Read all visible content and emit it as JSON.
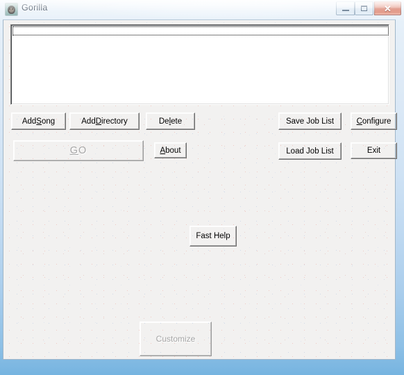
{
  "window": {
    "title": "Gorilla",
    "icon": "gorilla-icon",
    "controls": {
      "minimize_label": "–",
      "maximize_label": "□",
      "close_label": "✕"
    },
    "colors": {
      "frame_glass": "#a9cdec",
      "client_background": "#f2f1f0",
      "close_button": "#cf5f48",
      "title_text": "#16273c",
      "disabled_text": "#a6a6a6"
    }
  },
  "list_box": {
    "name": "job-list",
    "items": [],
    "focused": true,
    "empty": true
  },
  "buttons": {
    "add_song": {
      "label_before": "Add ",
      "accel": "S",
      "label_after": "ong",
      "enabled": true
    },
    "add_directory": {
      "label_before": "Add ",
      "accel": "D",
      "label_after": "irectory",
      "enabled": true
    },
    "delete": {
      "label_before": "De",
      "accel": "l",
      "label_after": "ete",
      "enabled": true
    },
    "save_job_list": {
      "label_before": "Save Job List",
      "accel": "",
      "label_after": "",
      "enabled": true
    },
    "configure": {
      "label_before": "",
      "accel": "C",
      "label_after": "onfigure",
      "enabled": true
    },
    "go": {
      "label_before": "",
      "accel": "G",
      "label_after": "O",
      "enabled": false
    },
    "about": {
      "label_before": "",
      "accel": "A",
      "label_after": "bout",
      "enabled": true
    },
    "load_job_list": {
      "label_before": "Load Job List",
      "accel": "",
      "label_after": "",
      "enabled": true
    },
    "exit": {
      "label_before": "Exit",
      "accel": "",
      "label_after": "",
      "enabled": true
    },
    "fast_help": {
      "label_before": "Fast Help",
      "accel": "",
      "label_after": "",
      "enabled": true
    },
    "customize": {
      "label_before": "Customize",
      "accel": "",
      "label_after": "",
      "enabled": false
    }
  }
}
